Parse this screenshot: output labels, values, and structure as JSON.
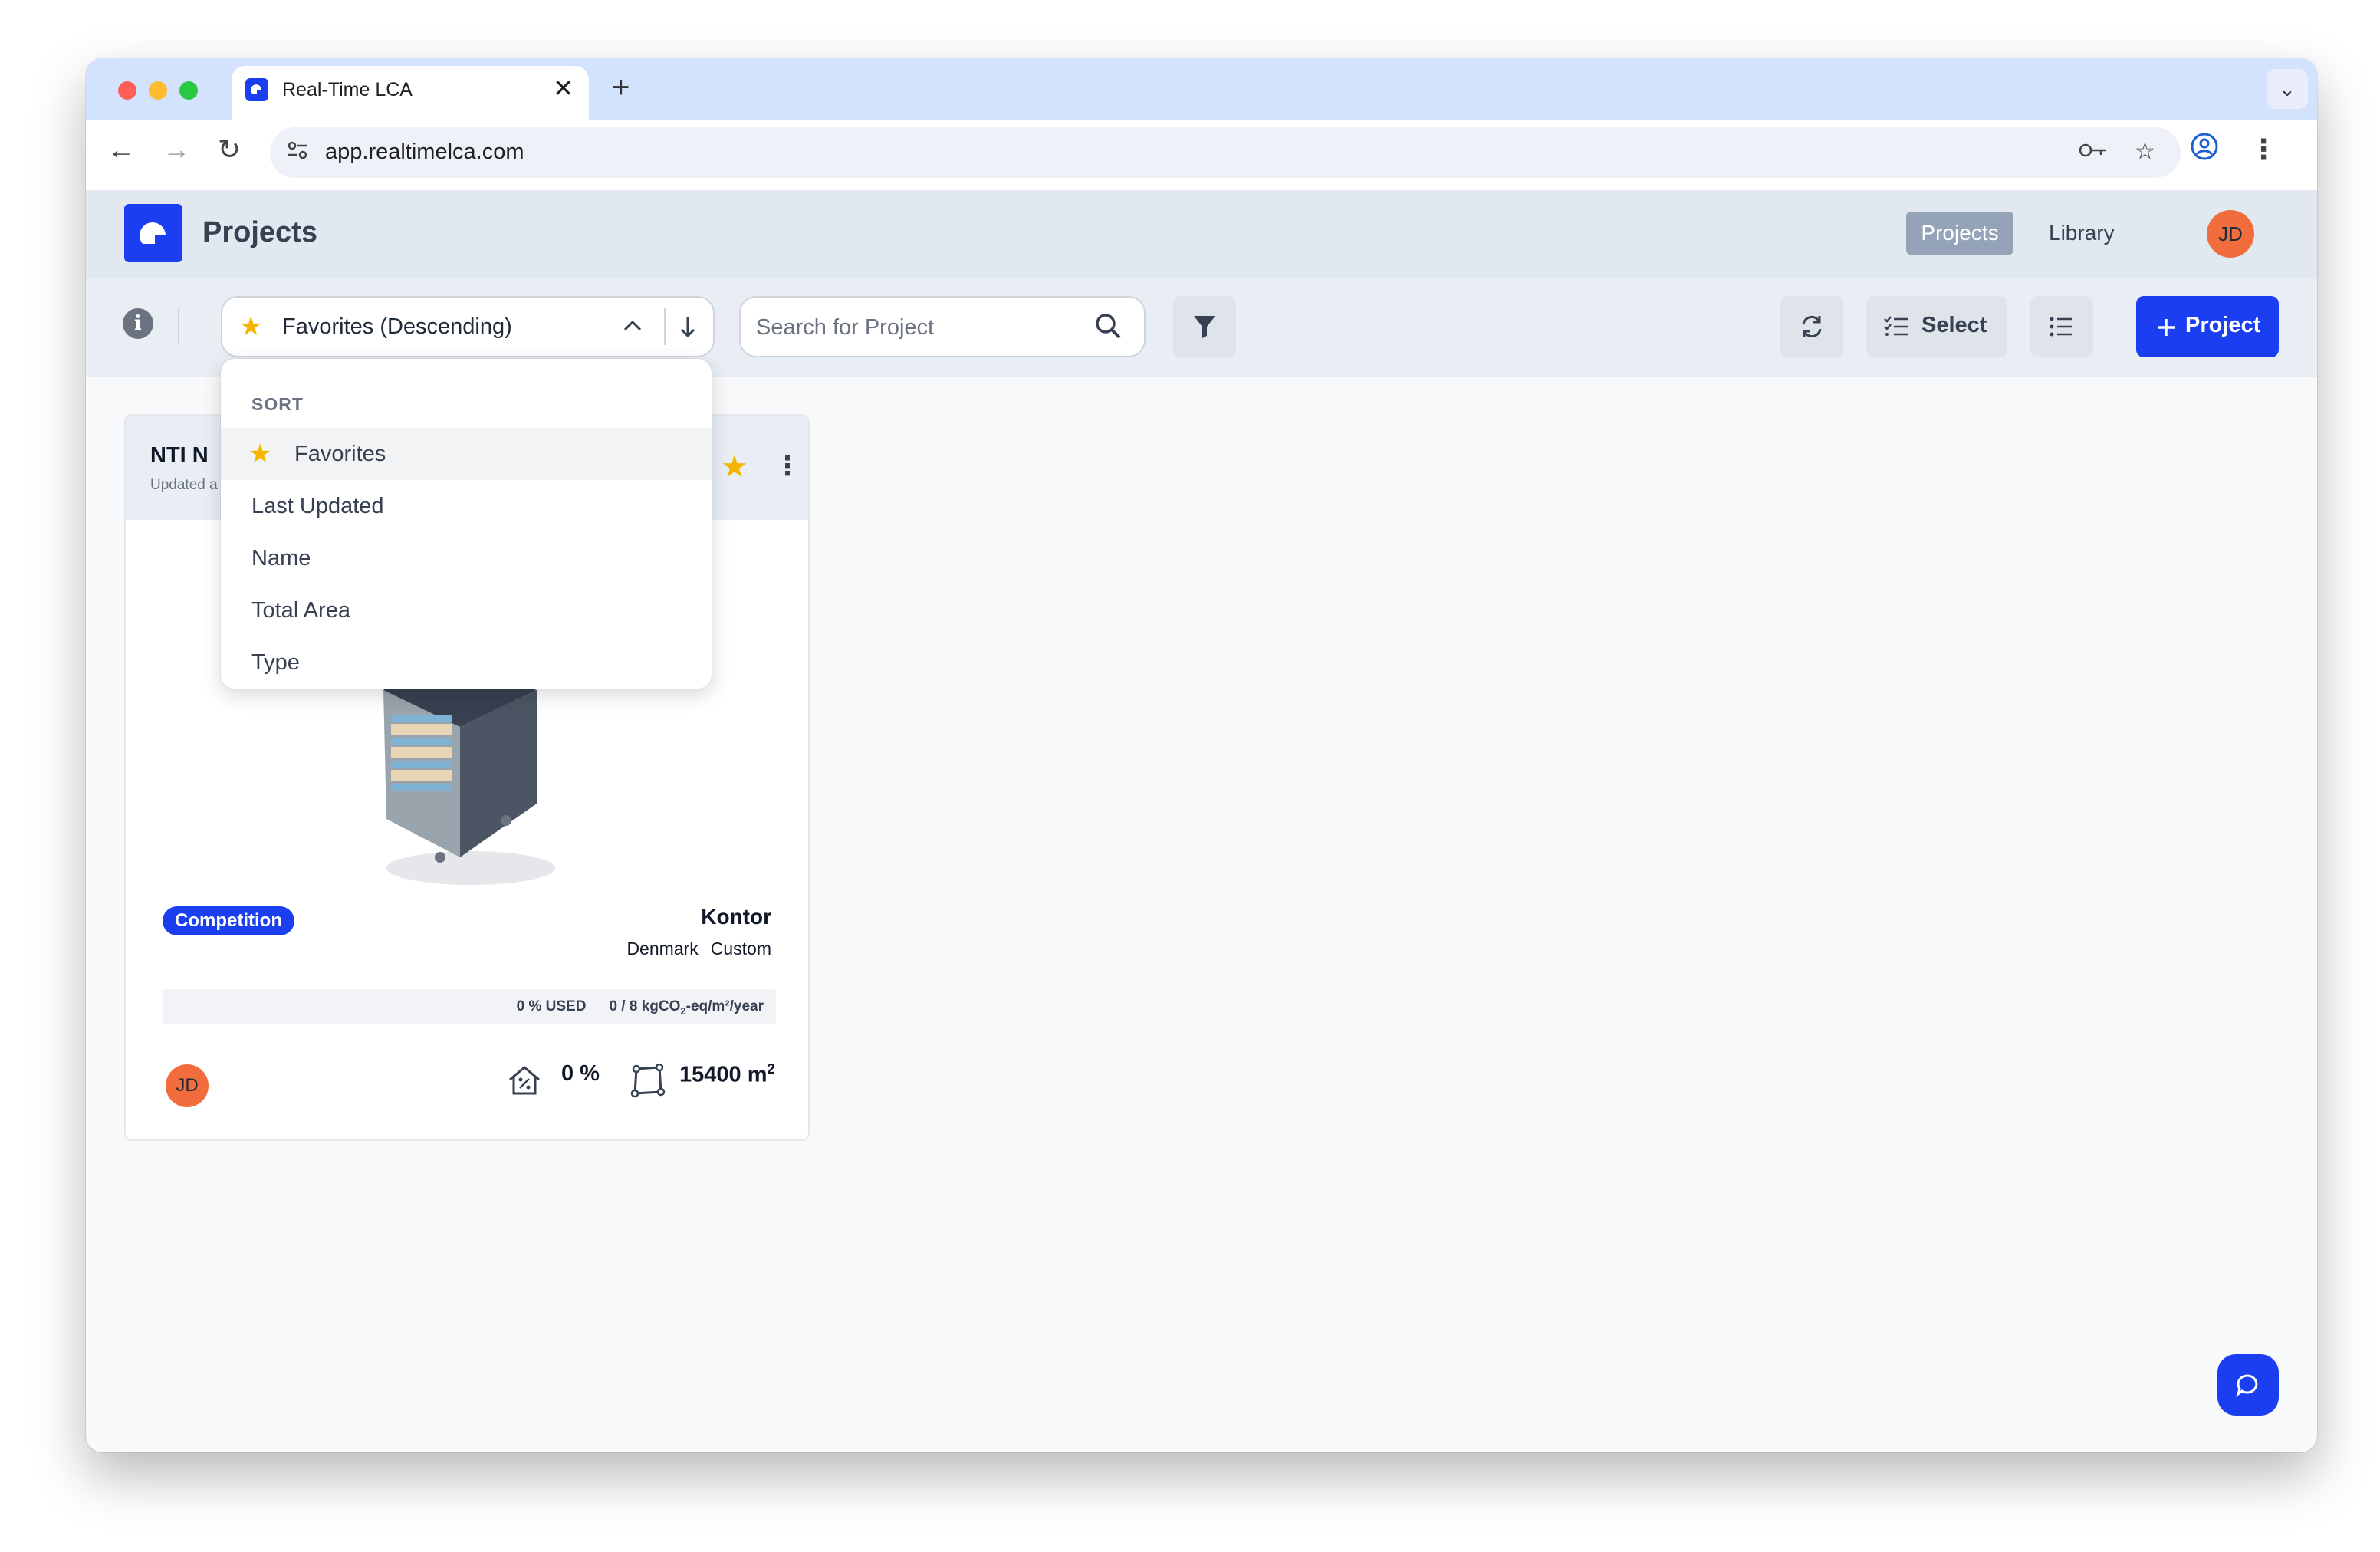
{
  "browser": {
    "tab_title": "Real-Time LCA",
    "tab_close": "✕",
    "new_tab": "+",
    "url": "app.realtimelca.com"
  },
  "app": {
    "page_title": "Projects",
    "nav": {
      "projects": "Projects",
      "library": "Library"
    },
    "user_initials": "JD",
    "brand_color": "#1b3ef0"
  },
  "filterbar": {
    "sort_selected": "Favorites (Descending)",
    "search_placeholder": "Search for Project",
    "select_label": "Select",
    "new_project_label": "Project"
  },
  "sort_menu": {
    "heading": "SORT",
    "options": [
      "Favorites",
      "Last Updated",
      "Name",
      "Total Area",
      "Type"
    ],
    "selected": "Favorites"
  },
  "project_card": {
    "title": "NTI N",
    "subtitle": "Updated a",
    "favorite": true,
    "badge": "Competition",
    "building_type": "Kontor",
    "country": "Denmark",
    "standard": "Custom",
    "usage_percent_label": "0 % USED",
    "usage_values": "0 / 8",
    "usage_unit_pre": "kgCO",
    "usage_unit_sub": "2",
    "usage_unit_post": "-eq/m²/year",
    "owner_initials": "JD",
    "completion": "0 %",
    "area_value": "15400 m",
    "area_sup": "2"
  }
}
